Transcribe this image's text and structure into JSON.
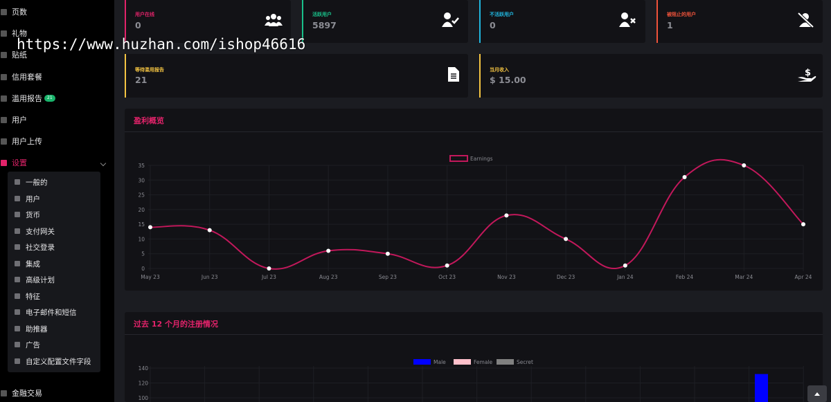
{
  "watermark": "https://www.huzhan.com/ishop46616",
  "sidebar": {
    "items": [
      {
        "label": "页数",
        "icon": "file-icon"
      },
      {
        "label": "礼物",
        "icon": "gift-icon"
      },
      {
        "label": "贴纸",
        "icon": "sticker-icon"
      },
      {
        "label": "信用套餐",
        "icon": "credit-card-icon"
      },
      {
        "label": "滥用报告",
        "icon": "flag-icon",
        "badge": "21"
      },
      {
        "label": "用户",
        "icon": "users-icon"
      },
      {
        "label": "用户上传",
        "icon": "upload-icon"
      },
      {
        "label": "设置",
        "icon": "cogs-icon",
        "active": true
      }
    ],
    "settings_sub": [
      {
        "label": "一般的",
        "icon": "wrench-icon"
      },
      {
        "label": "用户",
        "icon": "user-icon"
      },
      {
        "label": "货币",
        "icon": "money-icon"
      },
      {
        "label": "支付网关",
        "icon": "credit-card-icon"
      },
      {
        "label": "社交登录",
        "icon": "share-icon"
      },
      {
        "label": "集成",
        "icon": "globe-icon"
      },
      {
        "label": "高级计划",
        "icon": "gem-icon"
      },
      {
        "label": "特征",
        "icon": "list-icon"
      },
      {
        "label": "电子邮件和短信",
        "icon": "mail-icon"
      },
      {
        "label": "助推器",
        "icon": "rocket-icon"
      },
      {
        "label": "广告",
        "icon": "ad-icon"
      },
      {
        "label": "自定义配置文件字段",
        "icon": "form-icon"
      }
    ],
    "bottom_item": {
      "label": "金融交易",
      "icon": "bank-icon"
    }
  },
  "cards": [
    {
      "label": "用户在线",
      "value": "0",
      "color": "#e2236a",
      "icon": "users-group-icon"
    },
    {
      "label": "活跃用户",
      "value": "5897",
      "color": "#19c08a",
      "icon": "user-check-icon"
    },
    {
      "label": "不活跃用户",
      "value": "0",
      "color": "#20b7e0",
      "icon": "user-times-icon"
    },
    {
      "label": "被阻止的用户",
      "value": "1",
      "color": "#f0533b",
      "icon": "user-slash-icon"
    },
    {
      "label": "等待滥用报告",
      "value": "21",
      "color": "#f5c542",
      "icon": "document-icon"
    },
    {
      "label": "当月收入",
      "value": "$ 15.00",
      "color": "#f5c542",
      "icon": "hand-dollar-icon"
    }
  ],
  "earnings_panel": {
    "title": "盈利概览"
  },
  "registrations_panel": {
    "title": "过去 12 个月的注册情况"
  },
  "chart_data": [
    {
      "type": "line",
      "title": "",
      "categories": [
        "May 23",
        "Jun 23",
        "Jul 23",
        "Aug 23",
        "Sep 23",
        "Oct 23",
        "Nov 23",
        "Dec 23",
        "Jan 24",
        "Feb 24",
        "Mar 24",
        "Apr 24"
      ],
      "series": [
        {
          "name": "Earnings",
          "values": [
            14,
            13,
            0,
            6,
            5,
            1,
            18,
            10,
            1,
            31,
            35,
            15
          ],
          "color": "#c2185b"
        }
      ],
      "ylim": [
        0,
        35
      ],
      "yticks": [
        0,
        5,
        10,
        15,
        20,
        25,
        30,
        35
      ],
      "legend": "top-center",
      "grid": true
    },
    {
      "type": "bar",
      "title": "",
      "legend_entries": [
        {
          "name": "Male",
          "color": "#0000ff"
        },
        {
          "name": "Female",
          "color": "#ffc0cb"
        },
        {
          "name": "Secret",
          "color": "#808080"
        }
      ],
      "yticks_visible": [
        100,
        120,
        140
      ],
      "visible_bars": [
        {
          "series": "Male",
          "value": 132
        }
      ],
      "legend": "top-center",
      "grid": true
    }
  ]
}
